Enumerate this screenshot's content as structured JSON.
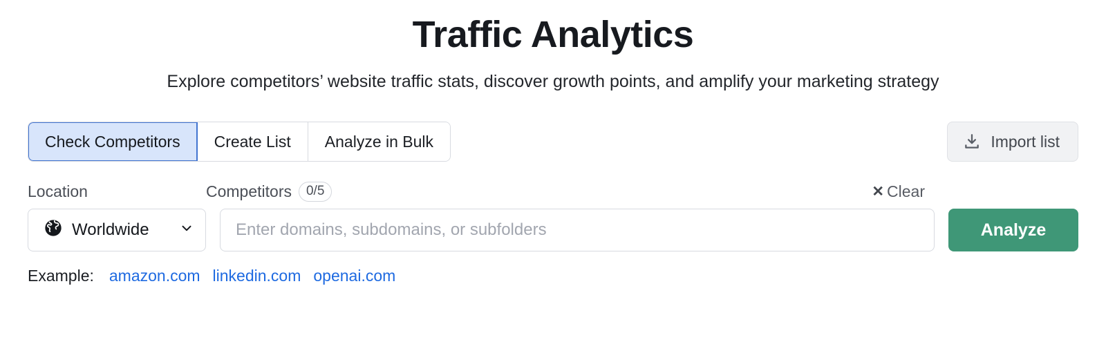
{
  "header": {
    "title": "Traffic Analytics",
    "subtitle": "Explore competitors’ website traffic stats, discover growth points, and amplify your marketing strategy"
  },
  "tabs": {
    "items": [
      {
        "label": "Check Competitors",
        "active": true
      },
      {
        "label": "Create List",
        "active": false
      },
      {
        "label": "Analyze in Bulk",
        "active": false
      }
    ],
    "import": {
      "label": "Import list",
      "icon": "download-icon"
    }
  },
  "form": {
    "location_label": "Location",
    "competitors_label": "Competitors",
    "competitors_count": "0/5",
    "clear_label": "Clear",
    "clear_icon": "close-icon",
    "location_value": "Worldwide",
    "location_icon": "globe-icon",
    "location_chevron": "chevron-down-icon",
    "domain_placeholder": "Enter domains, subdomains, or subfolders",
    "domain_value": "",
    "analyze_label": "Analyze"
  },
  "example": {
    "label": "Example:",
    "links": [
      "amazon.com",
      "linkedin.com",
      "openai.com"
    ]
  },
  "colors": {
    "accent_green": "#3f9777",
    "link_blue": "#1e6ae1",
    "active_tab_bg": "#d8e5fb",
    "active_tab_border": "#4274d0",
    "border_gray": "#d7dae0",
    "import_bg": "#f1f2f4",
    "text_dark": "#171a1f",
    "text_muted": "#4b4f57",
    "placeholder_gray": "#a2a6af"
  }
}
